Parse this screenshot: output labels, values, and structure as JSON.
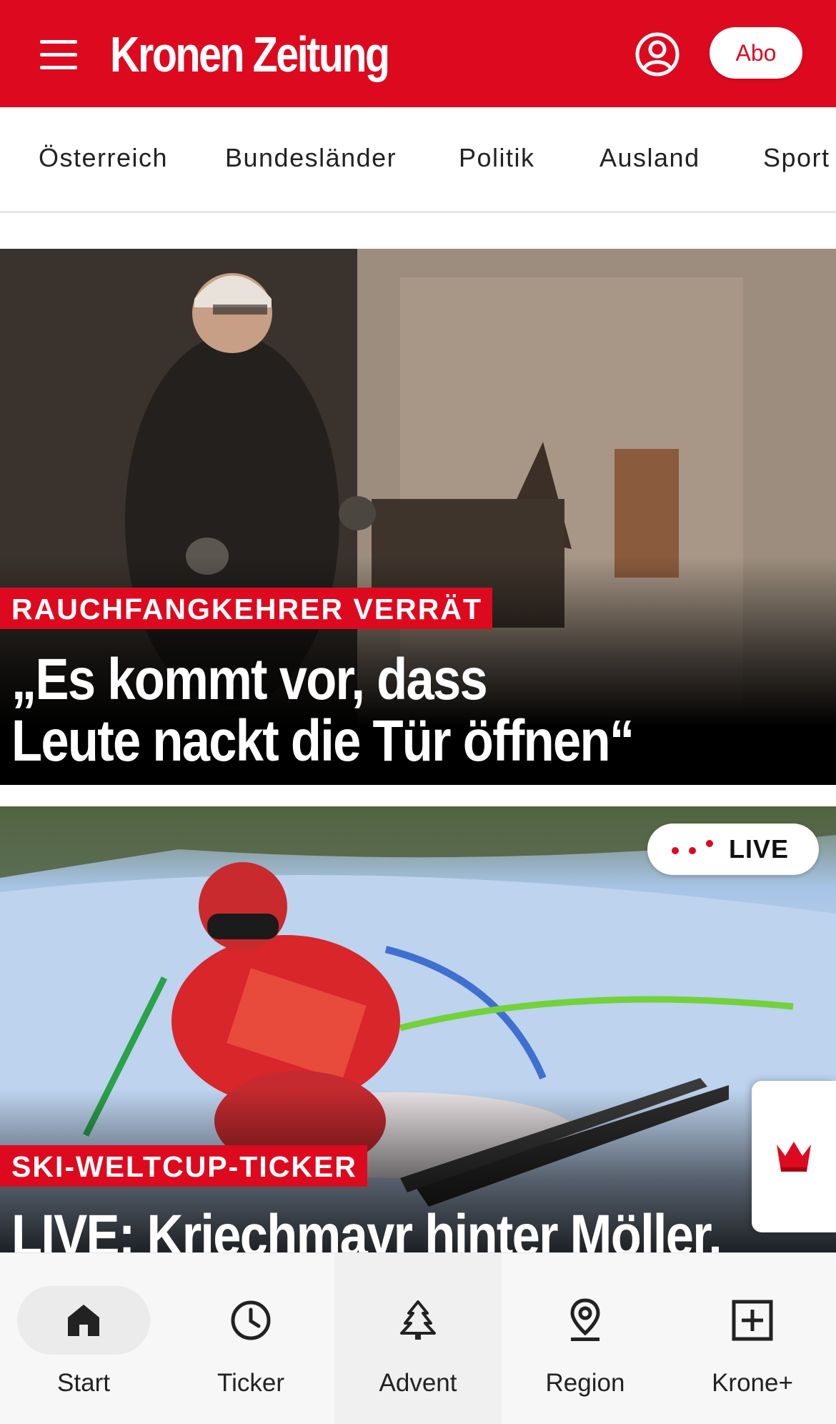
{
  "header": {
    "logo_text": "Kronen Zeitung",
    "abo_label": "Abo",
    "brand_color": "#dd0a1f",
    "menu_icon": "hamburger-menu-icon",
    "account_icon": "account-circle-icon"
  },
  "categories": [
    {
      "label": "Österreich"
    },
    {
      "label": "Bundesländer"
    },
    {
      "label": "Politik"
    },
    {
      "label": "Ausland"
    },
    {
      "label": "Sport"
    }
  ],
  "stories": [
    {
      "kicker": "RAUCHFANGKEHRER VERRÄT",
      "headline_line1": "„Es kommt vor, dass",
      "headline_line2": "Leute nackt die Tür öffnen“"
    },
    {
      "kicker": "SKI-WELTCUP-TICKER",
      "headline_line1": "LIVE: Kriechmayr hinter Möller,",
      "live_badge": "LIVE"
    }
  ],
  "krone_plus_tab_icon": "crown-icon",
  "bottom_nav": [
    {
      "label": "Start",
      "icon": "home-icon",
      "selected": true
    },
    {
      "label": "Ticker",
      "icon": "clock-icon"
    },
    {
      "label": "Advent",
      "icon": "christmas-tree-icon"
    },
    {
      "label": "Region",
      "icon": "location-pin-icon"
    },
    {
      "label": "Krone+",
      "icon": "plus-square-icon"
    }
  ]
}
